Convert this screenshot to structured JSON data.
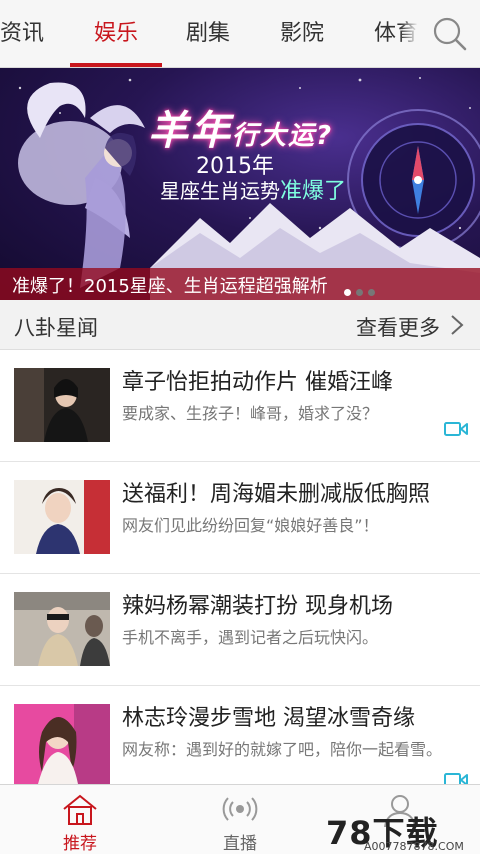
{
  "tabs": [
    {
      "label": "资讯",
      "active": false
    },
    {
      "label": "娱乐",
      "active": true
    },
    {
      "label": "剧集",
      "active": false
    },
    {
      "label": "影院",
      "active": false
    },
    {
      "label": "体育",
      "active": false
    }
  ],
  "banner": {
    "title_big": "羊年",
    "title_small": "行大运?",
    "year": "2015年",
    "subtitle_plain": "星座生肖运势",
    "subtitle_accent": "准爆了",
    "caption": "准爆了！2015星座、生肖运程超强解析",
    "slide_count": 3,
    "active_slide": 1
  },
  "section": {
    "title": "八卦星闻",
    "more": "查看更多"
  },
  "news": [
    {
      "title": "章子怡拒拍动作片 催婚汪峰",
      "desc": "要成家、生孩子！峰哥，婚求了没？",
      "video": true
    },
    {
      "title": "送福利！周海媚未删减版低胸照",
      "desc": "网友们见此纷纷回复“娘娘好善良”！",
      "video": false
    },
    {
      "title": "辣妈杨幂潮装打扮 现身机场",
      "desc": "手机不离手，遇到记者之后玩快闪。",
      "video": false
    },
    {
      "title": "林志玲漫步雪地 渴望冰雪奇缘",
      "desc": "网友称：遇到好的就嫁了吧，陪你一起看雪。",
      "video": true
    }
  ],
  "bottom_nav": [
    {
      "label": "推荐",
      "icon": "home-icon",
      "active": true
    },
    {
      "label": "直播",
      "icon": "broadcast-icon",
      "active": false
    },
    {
      "label": "",
      "icon": "user-icon",
      "active": false
    }
  ],
  "watermark": {
    "logo": "78下载",
    "url": "A007787878.COM"
  },
  "colors": {
    "accent": "#c8161d",
    "caption_bg": "#960a1e",
    "video_icon": "#2bb6d6"
  }
}
